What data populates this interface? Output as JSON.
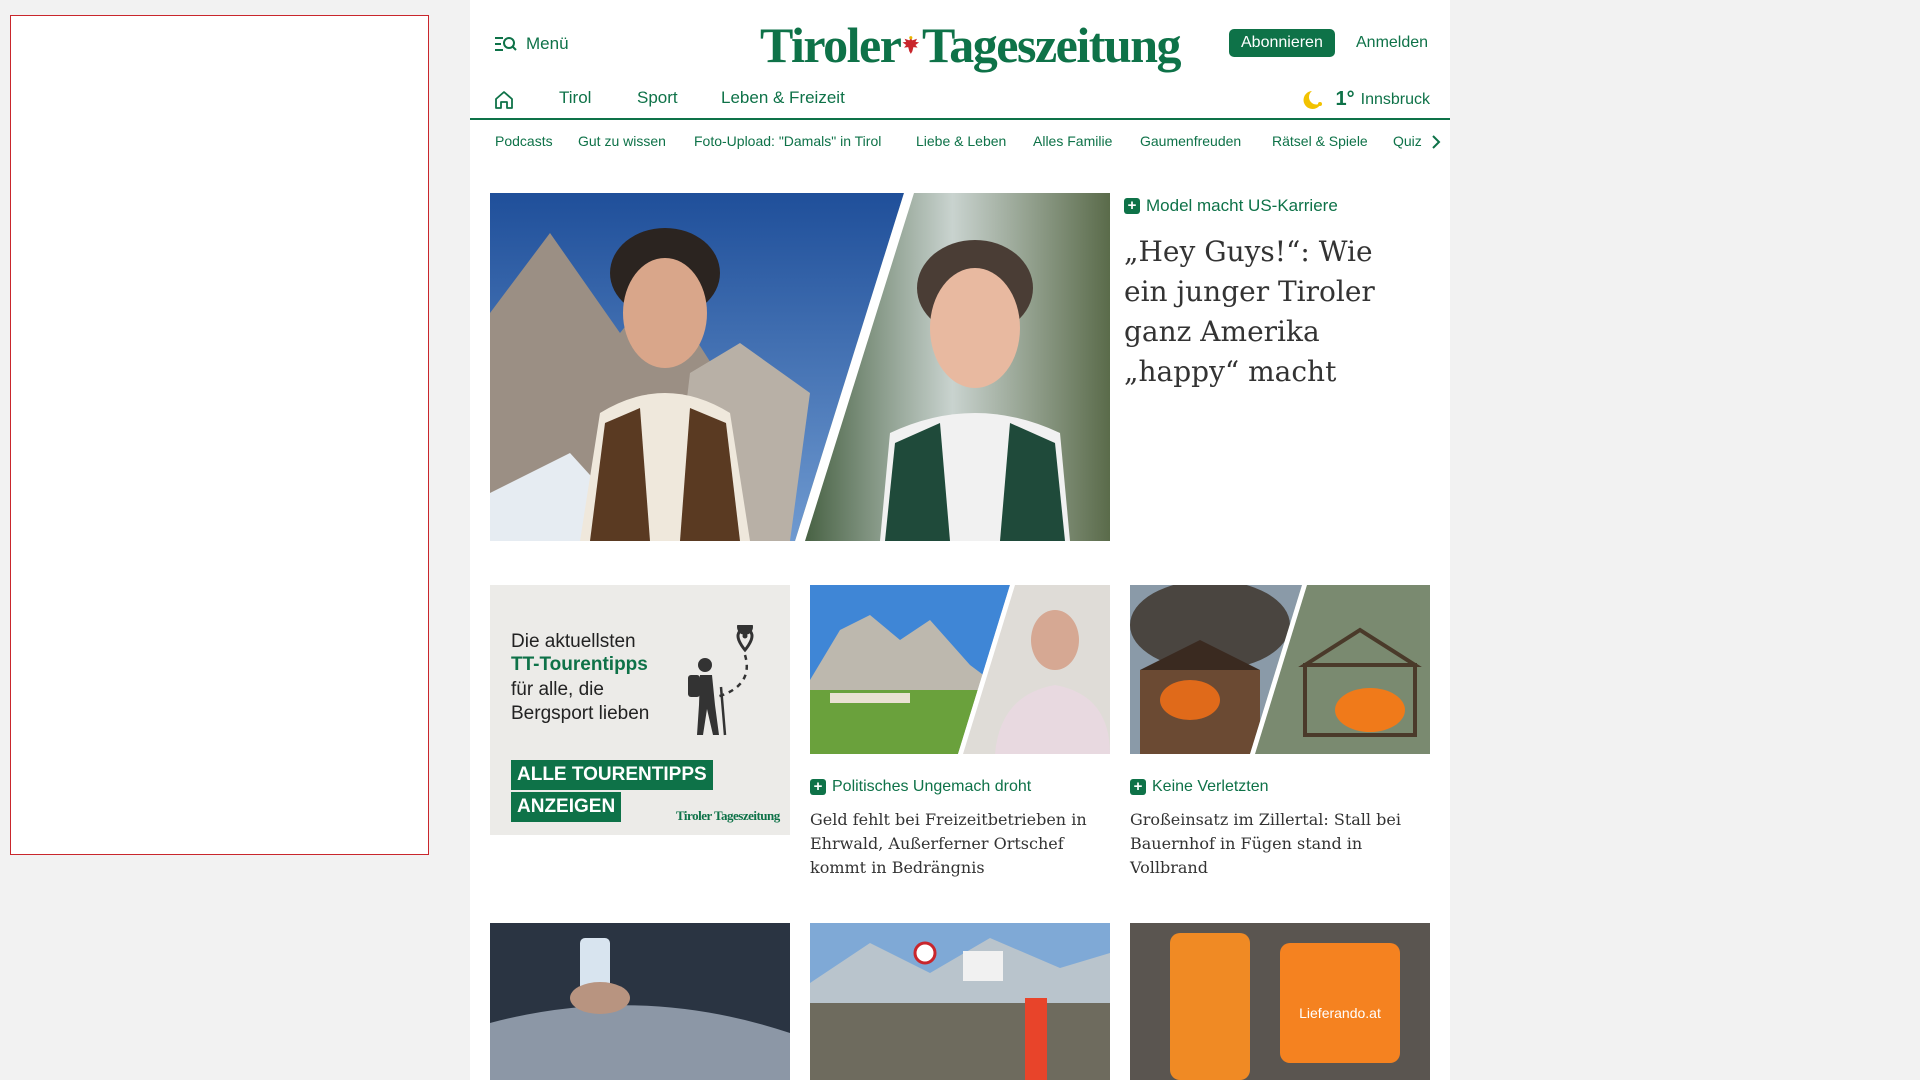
{
  "header": {
    "menu_label": "Menü",
    "logo_left": "Tiroler",
    "logo_right": "Tageszeitung",
    "subscribe_label": "Abonnieren",
    "login_label": "Anmelden"
  },
  "nav": {
    "items": [
      "Tirol",
      "Sport",
      "Leben & Freizeit"
    ],
    "weather_temp": "1°",
    "weather_city": "Innsbruck"
  },
  "subnav": {
    "items": [
      "Podcasts",
      "Gut zu wissen",
      "Foto-Upload: \"Damals\" in Tirol",
      "Liebe & Leben",
      "Alles Familie",
      "Gaumenfreuden",
      "Rätsel & Spiele",
      "Quiz"
    ]
  },
  "hero": {
    "kicker": "Model macht US-Karriere",
    "title": "„Hey Guys!“: Wie ein junger Tiroler ganz Amerika „happy“ macht"
  },
  "promo": {
    "line1": "Die aktuellsten",
    "line2": "TT-Tourentipps",
    "line3": "für alle, die Bergsport lieben",
    "cta1": "ALLE TOURENTIPPS",
    "cta2": "ANZEIGEN",
    "brand": "Tiroler Tageszeitung"
  },
  "articles": [
    {
      "kicker": "Politisches Ungemach droht",
      "title": "Geld fehlt bei Freizeitbetrieben in Ehrwald, Außerferner Ortschef kommt in Bedrängnis"
    },
    {
      "kicker": "Keine Verletzten",
      "title": "Großeinsatz im Zillertal: Stall bei Bauernhof in Fügen stand in Vollbrand"
    }
  ],
  "colors": {
    "brand_green": "#0e7248",
    "ad_border": "#c9262c",
    "weather_moon": "#f2c200"
  }
}
